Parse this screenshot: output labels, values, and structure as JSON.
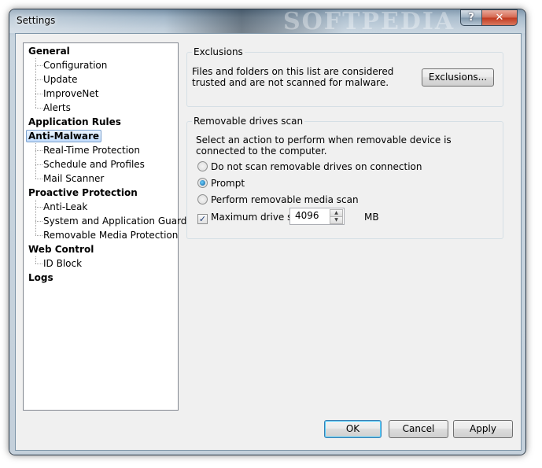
{
  "window": {
    "title": "Settings",
    "watermark": "SOFTPEDIA"
  },
  "titlebar_buttons": {
    "help": "?",
    "close": "✕"
  },
  "tree": [
    {
      "label": "General",
      "level": 0
    },
    {
      "label": "Configuration",
      "level": 1
    },
    {
      "label": "Update",
      "level": 1
    },
    {
      "label": "ImproveNet",
      "level": 1
    },
    {
      "label": "Alerts",
      "level": 1
    },
    {
      "label": "Application Rules",
      "level": 0
    },
    {
      "label": "Anti-Malware",
      "level": 0,
      "selected": true
    },
    {
      "label": "Real-Time Protection",
      "level": 1
    },
    {
      "label": "Schedule and Profiles",
      "level": 1
    },
    {
      "label": "Mail Scanner",
      "level": 1
    },
    {
      "label": "Proactive Protection",
      "level": 0
    },
    {
      "label": "Anti-Leak",
      "level": 1
    },
    {
      "label": "System and Application Guard",
      "level": 1
    },
    {
      "label": "Removable Media Protection",
      "level": 1
    },
    {
      "label": "Web Control",
      "level": 0
    },
    {
      "label": "ID Block",
      "level": 1
    },
    {
      "label": "Logs",
      "level": 0
    }
  ],
  "exclusions": {
    "title": "Exclusions",
    "description": "Files and folders on this list are considered trusted and are not scanned for malware.",
    "button": "Exclusions..."
  },
  "removable": {
    "title": "Removable drives scan",
    "description": "Select an action to perform when removable device is connected to the computer.",
    "options": [
      {
        "label": "Do not scan removable drives on connection",
        "checked": false
      },
      {
        "label": "Prompt",
        "checked": true
      },
      {
        "label": "Perform removable media scan",
        "checked": false
      }
    ],
    "max_size_label": "Maximum drive size",
    "max_size_checked": true,
    "max_size_value": "4096",
    "unit": "MB"
  },
  "footer": {
    "ok": "OK",
    "cancel": "Cancel",
    "apply": "Apply"
  }
}
